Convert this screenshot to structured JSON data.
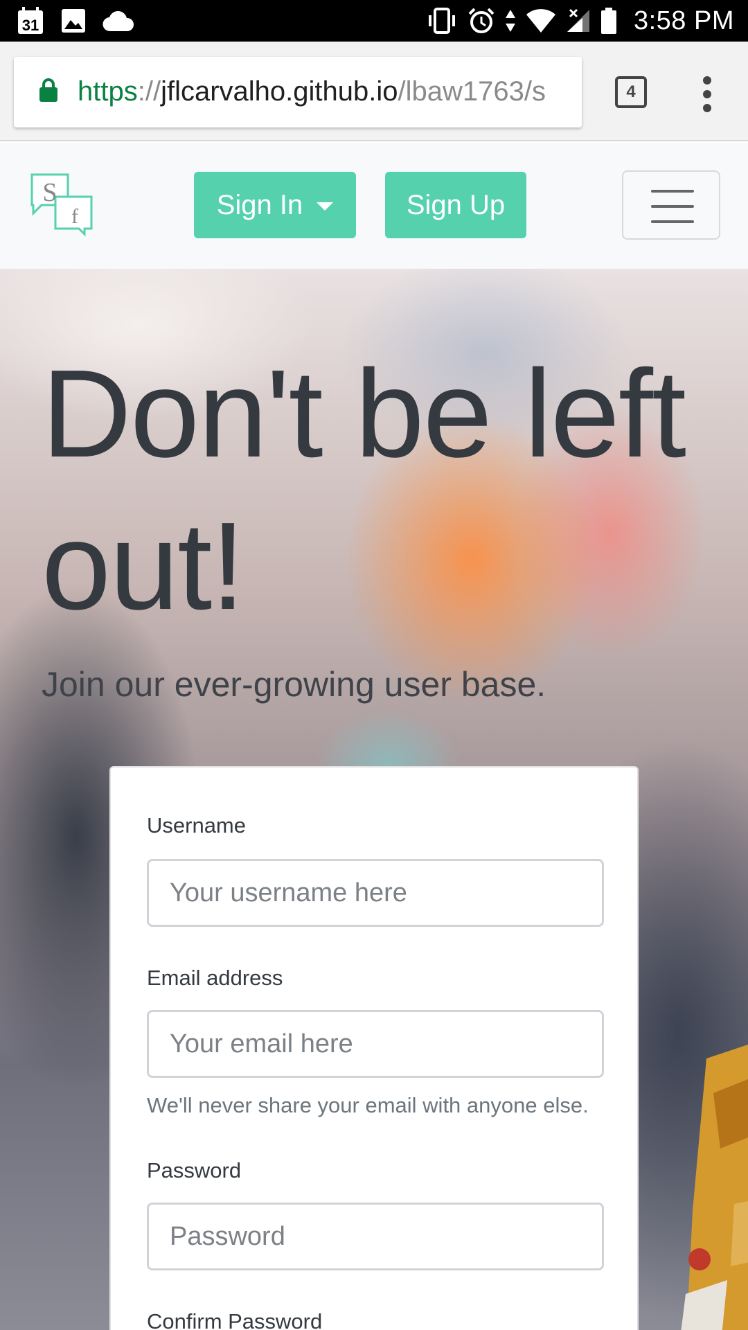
{
  "status_bar": {
    "time": "3:58 PM",
    "calendar_day": "31",
    "icons": [
      "calendar-icon",
      "image-icon",
      "cloud-icon",
      "vibrate-icon",
      "alarm-icon",
      "data-arrows-icon",
      "wifi-icon",
      "cell-signal-icon",
      "battery-icon"
    ]
  },
  "browser": {
    "url_scheme": "https",
    "url_separator": "://",
    "url_host": "jflcarvalho.github.io",
    "url_path": "/lbaw1763/s",
    "tab_count": "4"
  },
  "navbar": {
    "logo_letters": [
      "S",
      "f"
    ],
    "signin_label": "Sign In",
    "signup_label": "Sign Up"
  },
  "hero": {
    "title": "Don't be left out!",
    "subtitle": "Join our ever-growing user base."
  },
  "form": {
    "username_label": "Username",
    "username_placeholder": "Your username here",
    "email_label": "Email address",
    "email_placeholder": "Your email here",
    "email_help": "We'll never share your email with anyone else.",
    "password_label": "Password",
    "password_placeholder": "Password",
    "confirm_password_label": "Confirm Password"
  },
  "colors": {
    "accent": "#55d1ad",
    "url_secure_green": "#0b8043",
    "heading_text": "#343a40"
  }
}
